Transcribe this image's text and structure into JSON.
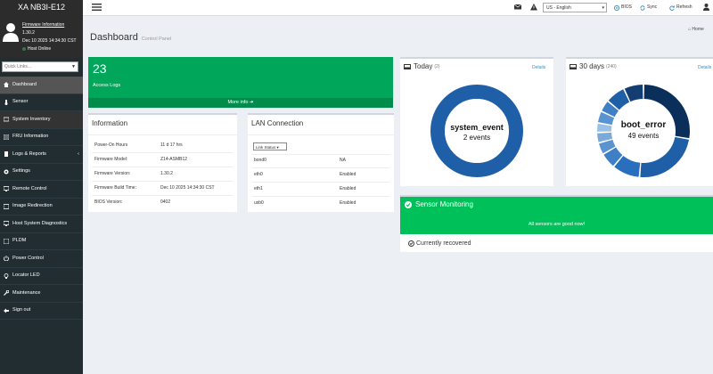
{
  "app_title": "XA NB3I-E12",
  "firmware": {
    "link": "Firmware Information",
    "version": "1.30.2",
    "datetime": "Dec 10 2025 14:34:30 CST",
    "status": "Host Online"
  },
  "quick_links_placeholder": "Quick Links...",
  "sidebar": {
    "items": [
      {
        "label": "Dashboard",
        "icon": "dashboard-icon"
      },
      {
        "label": "Sensor",
        "icon": "sensor-icon"
      },
      {
        "label": "System Inventory",
        "icon": "inventory-icon"
      },
      {
        "label": "FRU Information",
        "icon": "fru-icon"
      },
      {
        "label": "Logs & Reports",
        "icon": "logs-icon"
      },
      {
        "label": "Settings",
        "icon": "gear-icon"
      },
      {
        "label": "Remote Control",
        "icon": "monitor-icon"
      },
      {
        "label": "Image Redirection",
        "icon": "image-icon"
      },
      {
        "label": "Host System Diagnostics",
        "icon": "diagnostics-icon"
      },
      {
        "label": "PLDM",
        "icon": "pldm-icon"
      },
      {
        "label": "Power Control",
        "icon": "power-icon"
      },
      {
        "label": "Locator LED",
        "icon": "led-icon"
      },
      {
        "label": "Maintenance",
        "icon": "wrench-icon"
      },
      {
        "label": "Sign out",
        "icon": "signout-icon"
      }
    ]
  },
  "topbar": {
    "language": "US - English",
    "bios_label": "BIOS",
    "sync_label": "Sync",
    "refresh_label": "Refresh"
  },
  "page": {
    "title": "Dashboard",
    "subtitle": "Control Panel",
    "breadcrumb": "Home"
  },
  "access_logs": {
    "count": "23",
    "label": "Access Logs",
    "more_info": "More info"
  },
  "information": {
    "title": "Information",
    "rows": [
      {
        "label": "Power-On Hours",
        "value": "11 d 17 hrs"
      },
      {
        "label": "Firmware Model:",
        "value": "Z14-ASMB12"
      },
      {
        "label": "Firmware Version:",
        "value": "1.30.2"
      },
      {
        "label": "Firmware Build Time:",
        "value": "Dec 10 2025 14:34:30 CST"
      },
      {
        "label": "BIOS Version:",
        "value": "0402"
      }
    ]
  },
  "lan": {
    "title": "LAN Connection",
    "select_value": "Link Status",
    "rows": [
      {
        "label": "bond0",
        "value": "NA"
      },
      {
        "label": "eth0",
        "value": "Enabled"
      },
      {
        "label": "eth1",
        "value": "Enabled"
      },
      {
        "label": "usb0",
        "value": "Enabled"
      }
    ]
  },
  "today": {
    "title": "Today",
    "count_label": "(2)",
    "details": "Details",
    "event_name": "system_event",
    "event_count": "2 events",
    "color": "#1f5fa8"
  },
  "thirty_days": {
    "title": "30 days",
    "count_label": "(240)",
    "details": "Details",
    "event_name": "boot_error",
    "event_count": "49 events"
  },
  "sensor": {
    "title": "Sensor Monitoring",
    "message": "All sensors are good now!",
    "recovered": "Currently recovered"
  },
  "colors": {
    "sidebar_bg": "#222d32",
    "green": "#00a65a",
    "sensor_green": "#00c05a",
    "link_blue": "#3c8dbc"
  }
}
